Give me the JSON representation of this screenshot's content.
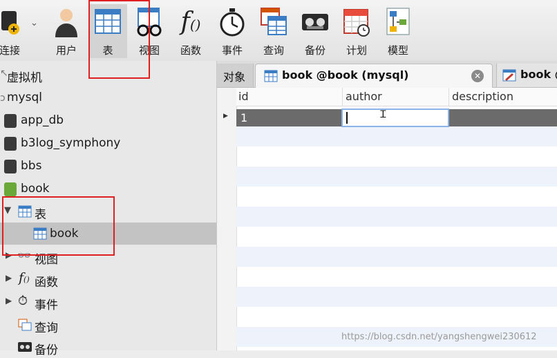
{
  "toolbar": {
    "items": [
      {
        "label": "连接",
        "icon": "connect-icon"
      },
      {
        "label": "用户",
        "icon": "user-icon"
      },
      {
        "label": "表",
        "icon": "table-icon"
      },
      {
        "label": "视图",
        "icon": "view-icon"
      },
      {
        "label": "函数",
        "icon": "function-icon"
      },
      {
        "label": "事件",
        "icon": "event-icon"
      },
      {
        "label": "查询",
        "icon": "query-icon"
      },
      {
        "label": "备份",
        "icon": "backup-icon"
      },
      {
        "label": "计划",
        "icon": "schedule-icon"
      },
      {
        "label": "模型",
        "icon": "model-icon"
      }
    ]
  },
  "sidebar": {
    "items": [
      {
        "label": "虚拟机"
      },
      {
        "label": "mysql"
      },
      {
        "label": "app_db"
      },
      {
        "label": "b3log_symphony"
      },
      {
        "label": "bbs"
      },
      {
        "label": "book"
      },
      {
        "label": "表"
      },
      {
        "label": "book"
      },
      {
        "label": "视图"
      },
      {
        "label": "函数"
      },
      {
        "label": "事件"
      },
      {
        "label": "查询"
      },
      {
        "label": "备份"
      }
    ]
  },
  "tabs": {
    "objects": "对象",
    "active": "book @book (mysql)",
    "second": "book @"
  },
  "grid": {
    "columns": [
      "id",
      "author",
      "description"
    ],
    "rows": [
      {
        "id": "1",
        "author": "",
        "description": ""
      }
    ],
    "cursor_glyph": "Ꮖ"
  },
  "watermark": "https://blog.csdn.net/yangshengwei230612",
  "colors": {
    "highlight": "#e02020",
    "selected_row": "#6b6b6b",
    "db_icon": "#3a3a3a",
    "db_open": "#6aa83a"
  }
}
